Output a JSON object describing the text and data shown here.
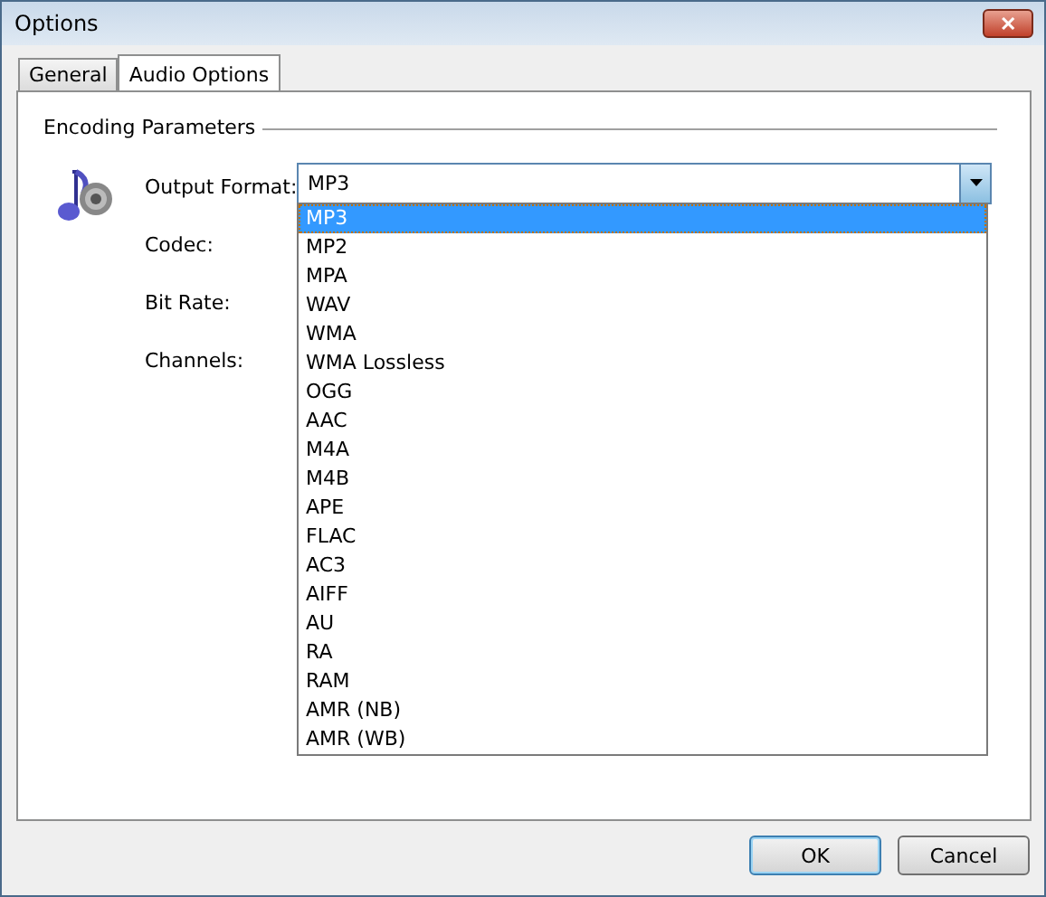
{
  "window": {
    "title": "Options",
    "close_glyph": "✕"
  },
  "tabs": [
    {
      "label": "General",
      "selected": false
    },
    {
      "label": "Audio Options",
      "selected": true
    }
  ],
  "group": {
    "title": "Encoding Parameters"
  },
  "fields": [
    {
      "label": "Output Format:"
    },
    {
      "label": "Codec:"
    },
    {
      "label": "Bit Rate:"
    },
    {
      "label": "Channels:"
    }
  ],
  "output_format": {
    "value": "MP3",
    "expanded": true,
    "options": [
      {
        "label": "MP3",
        "selected": true
      },
      {
        "label": "MP2",
        "selected": false
      },
      {
        "label": "MPA",
        "selected": false
      },
      {
        "label": "WAV",
        "selected": false
      },
      {
        "label": "WMA",
        "selected": false
      },
      {
        "label": "WMA Lossless",
        "selected": false
      },
      {
        "label": "OGG",
        "selected": false
      },
      {
        "label": "AAC",
        "selected": false
      },
      {
        "label": "M4A",
        "selected": false
      },
      {
        "label": "M4B",
        "selected": false
      },
      {
        "label": "APE",
        "selected": false
      },
      {
        "label": "FLAC",
        "selected": false
      },
      {
        "label": "AC3",
        "selected": false
      },
      {
        "label": "AIFF",
        "selected": false
      },
      {
        "label": "AU",
        "selected": false
      },
      {
        "label": "RA",
        "selected": false
      },
      {
        "label": "RAM",
        "selected": false
      },
      {
        "label": "AMR (NB)",
        "selected": false
      },
      {
        "label": "AMR (WB)",
        "selected": false
      }
    ]
  },
  "buttons": [
    {
      "label": "OK",
      "default": true
    },
    {
      "label": "Cancel",
      "default": false
    }
  ]
}
